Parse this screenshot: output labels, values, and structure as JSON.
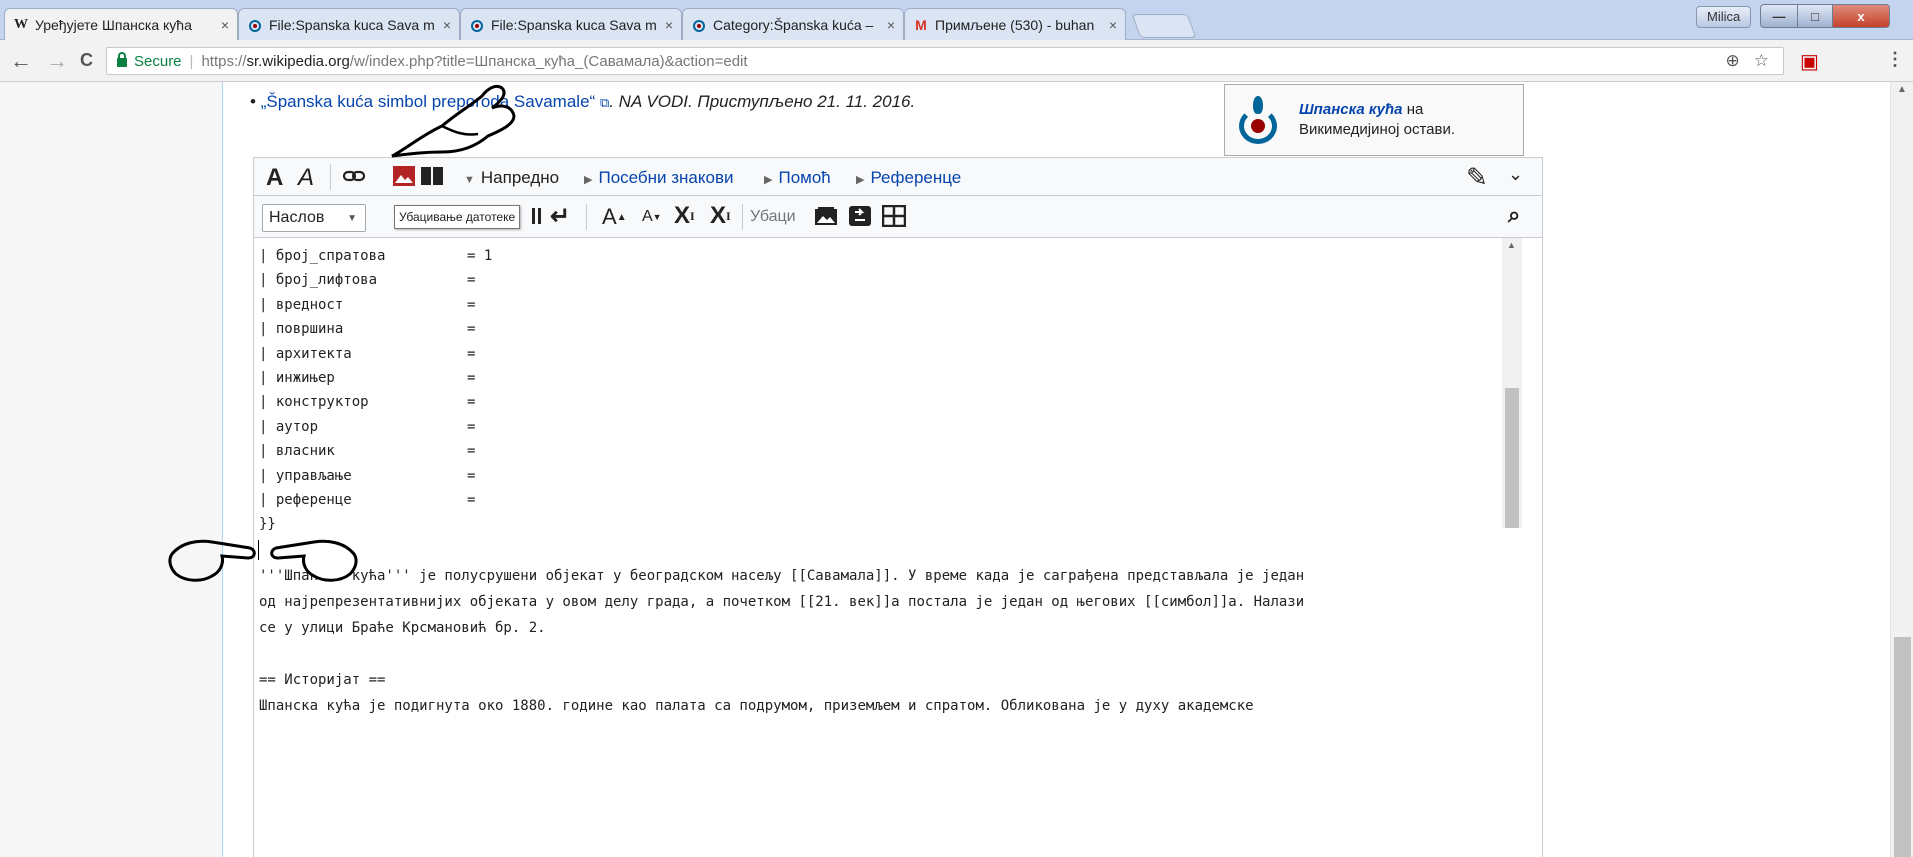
{
  "browser": {
    "tabs": [
      {
        "title": "Уређујете Шпанска кућа",
        "icon": "W",
        "close": "×"
      },
      {
        "title": "File:Spanska kuca Sava m",
        "icon": "commons",
        "close": "×"
      },
      {
        "title": "File:Spanska kuca Sava m",
        "icon": "commons",
        "close": "×"
      },
      {
        "title": "Category:Španska kuća –",
        "icon": "commons",
        "close": "×"
      },
      {
        "title": "Примљене (530) - buhan",
        "icon": "M",
        "close": "×"
      }
    ],
    "user": "Milica",
    "window_min": "—",
    "window_max": "□",
    "window_close": "x",
    "secure_label": "Secure",
    "separator": "|",
    "url_scheme": "https://",
    "url_host": "sr.wikipedia.org",
    "url_rest": "/w/index.php?title=Шпанска_кућа_(Савамала)&action=edit",
    "nav_back": "←",
    "nav_forward": "→",
    "nav_reload": "C",
    "zoom_glyph": "⊕",
    "star_glyph": "☆",
    "gift_glyph": "▣",
    "menu_glyph": "⋮"
  },
  "article": {
    "ref_bullet": "•",
    "ref_link": "„Španska kuća simbol preporoda Savamale“",
    "ref_ext": "⧉",
    "ref_tail": ". NA VODI. Приступљено 21. 11. 2016.",
    "commons_title": "Шпанска кућа",
    "commons_on": " на",
    "commons_line2": "Викимедијиној остави."
  },
  "editor": {
    "toolbar1": {
      "bold": "A",
      "italic": "A",
      "advanced": "Напредно",
      "special_chars": "Посебни знакови",
      "help": "Помоћ",
      "references": "Референце",
      "advanced_arrow": "▼",
      "expand_arrow": "▶",
      "pencil": "✎",
      "pencil_caret": "⌄"
    },
    "toolbar2": {
      "heading_select": "Наслов",
      "heading_caret": "▼",
      "tooltip": "Убацивање датотеке",
      "newline": "↵",
      "big": "A",
      "small": "A",
      "sup": "X",
      "sub": "X",
      "sup_mark": "I",
      "sub_mark": "I",
      "insert": "Убаци",
      "search": "⌕"
    },
    "infobox_lines": [
      {
        "key": "| број_спратова",
        "val": "= 1"
      },
      {
        "key": "| број_лифтова",
        "val": "="
      },
      {
        "key": "| вредност",
        "val": "="
      },
      {
        "key": "| површина",
        "val": "="
      },
      {
        "key": "| архитекта",
        "val": "="
      },
      {
        "key": "| инжињер",
        "val": "="
      },
      {
        "key": "| конструктор",
        "val": "="
      },
      {
        "key": "| аутор",
        "val": "="
      },
      {
        "key": "| власник",
        "val": "="
      },
      {
        "key": "| управљање",
        "val": "="
      },
      {
        "key": "| референце",
        "val": "="
      },
      {
        "key": "}}",
        "val": ""
      }
    ],
    "body_lines": [
      "'''Шпанска кућа''' је полусрушени објекат у београдском насељу [[Савамала]]. У време када је саграђена представљала је један",
      "од најрепрезентативнијих објеката у овом делу града, а почетком [[21. век]]а постала је један од његових [[симбол]]а. Налази",
      "се у улици Браће Крсмановић бр. 2.",
      "",
      "== Историјат ==",
      "Шпанска кућа је подигнута око 1880. године као палата са подрумом, приземљем и спратом. Обликована је у духу академске"
    ]
  }
}
